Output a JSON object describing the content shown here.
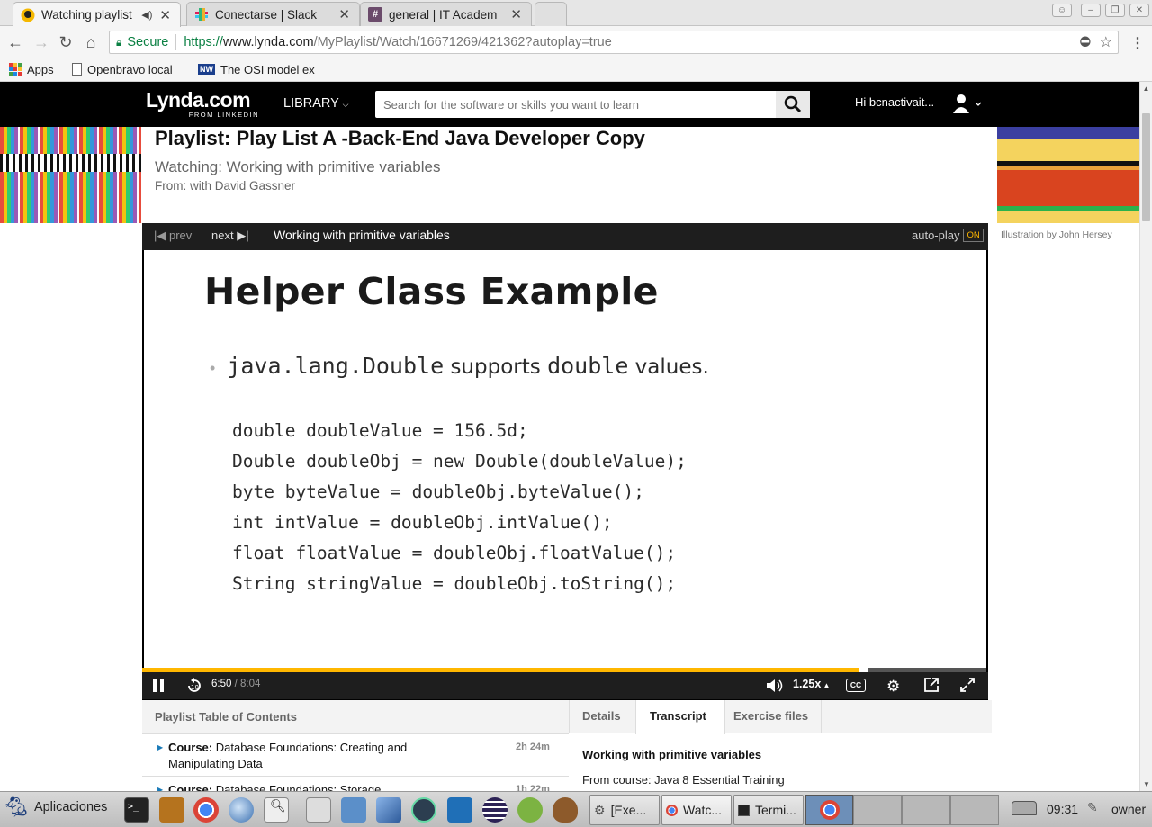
{
  "browser": {
    "tabs": [
      {
        "title": "Watching playlist",
        "active": true
      },
      {
        "title": "Conectarse | Slack",
        "active": false
      },
      {
        "title": "general | IT Academ",
        "active": false
      }
    ],
    "secure_label": "Secure",
    "url_scheme": "https://",
    "url_host": "www.lynda.com",
    "url_path": "/MyPlaylist/Watch/16671269/421362?autoplay=true",
    "bookmarks": [
      "Apps",
      "Openbravo local",
      "The OSI model ex"
    ]
  },
  "header": {
    "logo": "Lynda.com",
    "logo_sub": "FROM LINKEDIN",
    "library_label": "LIBRARY",
    "search_placeholder": "Search for the software or skills you want to learn",
    "greeting": "Hi bcnactivait..."
  },
  "playlist": {
    "title": "Playlist: Play List A -Back-End Java Developer Copy",
    "watching": "Watching: Working with primitive variables",
    "from": "From: with David Gassner",
    "illustration_credit": "Illustration by John Hersey"
  },
  "player": {
    "prev_label": "prev",
    "next_label": "next",
    "video_title": "Working with primitive variables",
    "autoplay_label": "auto-play",
    "autoplay_state": "ON",
    "current_time": "6:50",
    "separator": " / ",
    "duration": "8:04",
    "progress": 0.855,
    "speed": "1.25x",
    "cc_label": "CC"
  },
  "slide": {
    "heading": "Helper Class Example",
    "bullet_code_1": "java.lang.Double",
    "bullet_text_1": " supports ",
    "bullet_code_2": "double",
    "bullet_text_2": " values.",
    "code_lines": [
      "double doubleValue = 156.5d;",
      "Double doubleObj = new Double(doubleValue);",
      "byte byteValue = doubleObj.byteValue();",
      "int intValue = doubleObj.intValue();",
      "float floatValue = doubleObj.floatValue();",
      "String stringValue = doubleObj.toString();"
    ]
  },
  "toc": {
    "heading": "Playlist Table of Contents",
    "items": [
      {
        "prefix": "Course:",
        "title": " Database Foundations: Creating and",
        "title2": "Manipulating Data",
        "duration": "2h 24m"
      },
      {
        "prefix": "Course:",
        "title": " Database Foundations: Storage",
        "title2": "",
        "duration": "1h 22m"
      }
    ]
  },
  "details": {
    "tabs": [
      "Details",
      "Transcript",
      "Exercise files"
    ],
    "active_tab": "Transcript",
    "heading": "Working with primitive variables",
    "from_course": "From course: Java 8 Essential Training"
  },
  "taskbar": {
    "apps_label": "Aplicaciones",
    "tasks": [
      "[Exe...",
      "Watc...",
      "Termi..."
    ],
    "clock": "09:31",
    "user": "owner"
  },
  "colors": {
    "accent": "#ffb700",
    "header_bg": "#000000",
    "secure_green": "#0b8043"
  }
}
